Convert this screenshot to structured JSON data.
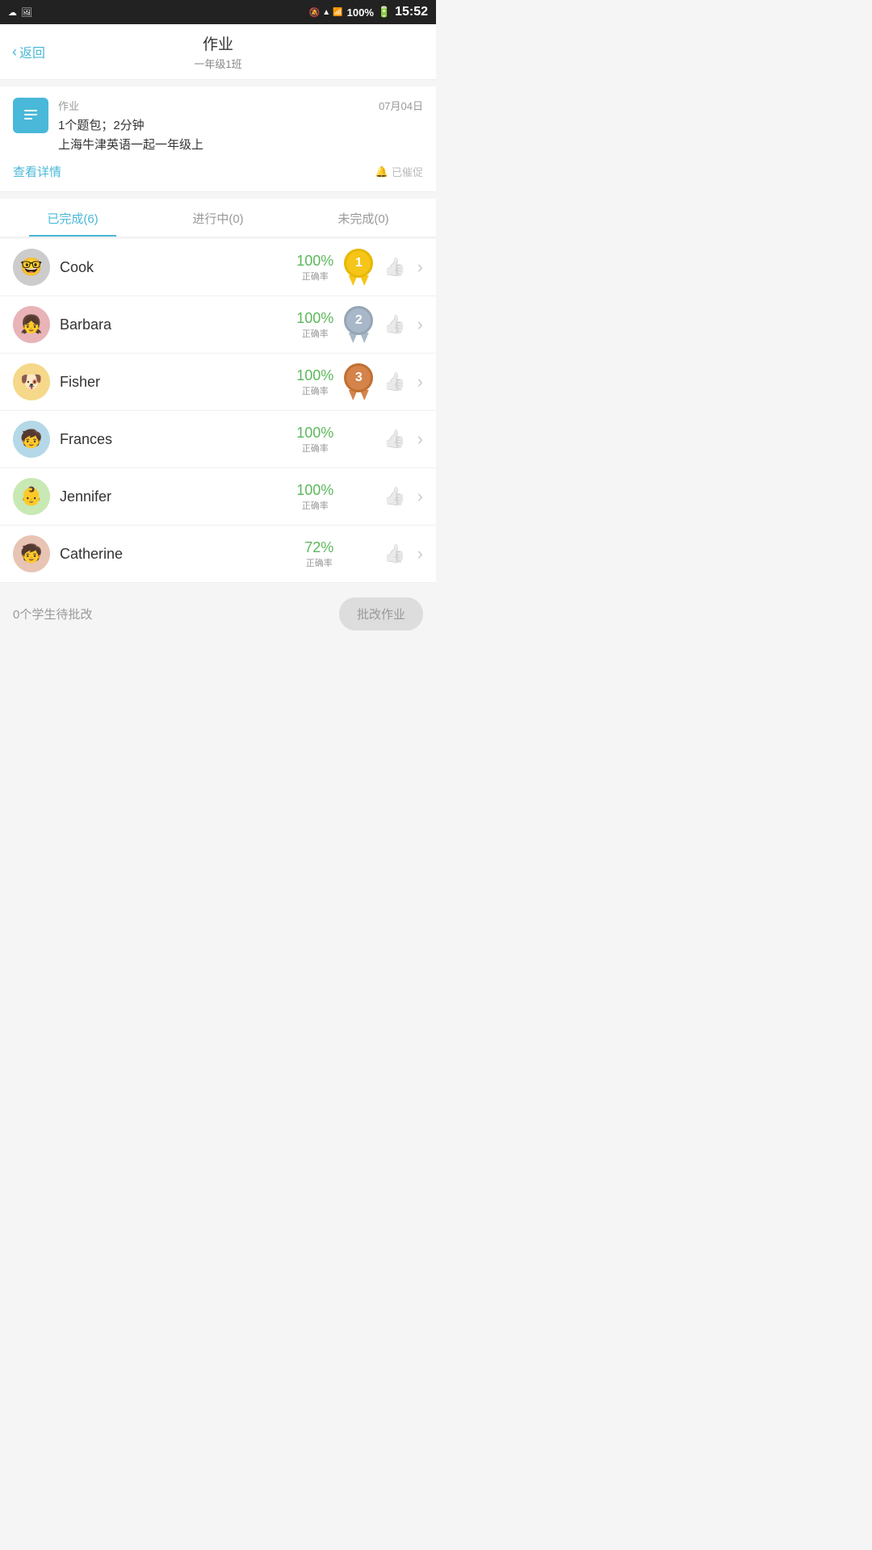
{
  "statusBar": {
    "time": "15:52",
    "battery": "100%"
  },
  "header": {
    "back_label": "返回",
    "title": "作业",
    "subtitle": "一年级1班"
  },
  "assignment": {
    "label": "作业",
    "date": "07月04日",
    "desc_line1": "1个题包；2分钟",
    "desc_line2": "上海牛津英语一起一年级上",
    "view_detail": "查看详情",
    "remind": "已催促"
  },
  "tabs": [
    {
      "label": "已完成(6)",
      "active": true
    },
    {
      "label": "进行中(0)",
      "active": false
    },
    {
      "label": "未完成(0)",
      "active": false
    }
  ],
  "students": [
    {
      "name": "Cook",
      "percent": "100%",
      "percent_label": "正确率",
      "medal": 1,
      "avatar_emoji": "🤓"
    },
    {
      "name": "Barbara",
      "percent": "100%",
      "percent_label": "正确率",
      "medal": 2,
      "avatar_emoji": "👧"
    },
    {
      "name": "Fisher",
      "percent": "100%",
      "percent_label": "正确率",
      "medal": 3,
      "avatar_emoji": "🐶"
    },
    {
      "name": "Frances",
      "percent": "100%",
      "percent_label": "正确率",
      "medal": 0,
      "avatar_emoji": "🧒"
    },
    {
      "name": "Jennifer",
      "percent": "100%",
      "percent_label": "正确率",
      "medal": 0,
      "avatar_emoji": "👶"
    },
    {
      "name": "Catherine",
      "percent": "72%",
      "percent_label": "正确率",
      "medal": 0,
      "avatar_emoji": "🧒"
    }
  ],
  "bottomBar": {
    "text": "0个学生待批改",
    "button": "批改作业"
  },
  "medalColors": {
    "1": "#f5c518",
    "2": "#a8b8c8",
    "3": "#d4834a"
  }
}
